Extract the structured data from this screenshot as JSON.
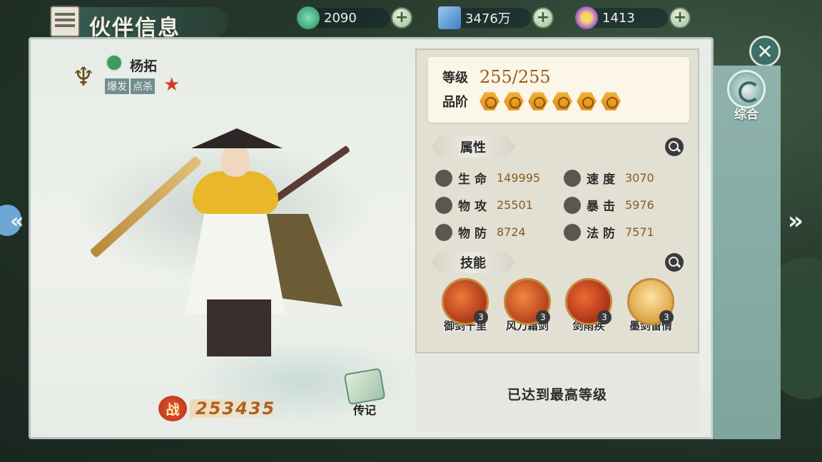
{
  "header": {
    "title": "伙伴信息",
    "resources": [
      {
        "icon": "jade-icon",
        "value": "2090",
        "color": "#3aa57a"
      },
      {
        "icon": "silver-ticket-icon",
        "value": "3476万",
        "color": "#3f7dc6"
      },
      {
        "icon": "spirit-orb-icon",
        "value": "1413",
        "color": "#a04fd6"
      }
    ]
  },
  "sidebar": {
    "general_tab": "综合"
  },
  "hero": {
    "name": "杨拓",
    "tags": [
      "爆发",
      "点杀"
    ],
    "combat_label": "战",
    "combat_power": "253435",
    "biography_label": "传记"
  },
  "level": {
    "level_label": "等级",
    "level_value": "255/255",
    "grade_label": "品阶",
    "grade_count": 6
  },
  "attributes": {
    "title": "属性",
    "items": [
      {
        "label": "生命",
        "value": "149995",
        "icon": "heart-icon"
      },
      {
        "label": "速度",
        "value": "3070",
        "icon": "speed-icon"
      },
      {
        "label": "物攻",
        "value": "25501",
        "icon": "sword-icon"
      },
      {
        "label": "暴击",
        "value": "5976",
        "icon": "crit-icon"
      },
      {
        "label": "物防",
        "value": "8724",
        "icon": "shield-icon"
      },
      {
        "label": "法防",
        "value": "7571",
        "icon": "magic-shield-icon"
      }
    ]
  },
  "skills": {
    "title": "技能",
    "items": [
      {
        "name": "御剑千里",
        "level": "3",
        "color": "#c0331c"
      },
      {
        "name": "风刀霜剑",
        "level": "3",
        "color": "#c43a1e"
      },
      {
        "name": "剑雨疾",
        "level": "3",
        "color": "#c42f1b"
      },
      {
        "name": "墨剑留情",
        "level": "3",
        "color": "#d79a2a"
      }
    ]
  },
  "footer": {
    "max_level_text": "已达到最高等级"
  }
}
